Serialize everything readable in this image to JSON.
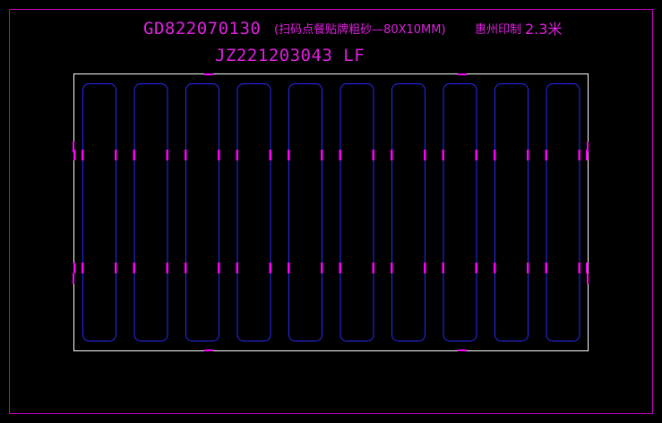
{
  "drawing": {
    "title_code": "GD822070130",
    "title_desc": "(扫码点餐贴牌粗砂—80X10MM)",
    "title_location": "惠州印制",
    "title_thickness": "2.3米",
    "job_code": "JZ221203043 LF"
  },
  "layout": {
    "slot_count": 10,
    "tab_rows": 2
  },
  "colors": {
    "background": "#000000",
    "outer_frame": "#c000c0",
    "board_outline": "#ffffff",
    "slots": "#2a2aff",
    "tabs": "#ff00ff",
    "text": "#e020e0"
  }
}
